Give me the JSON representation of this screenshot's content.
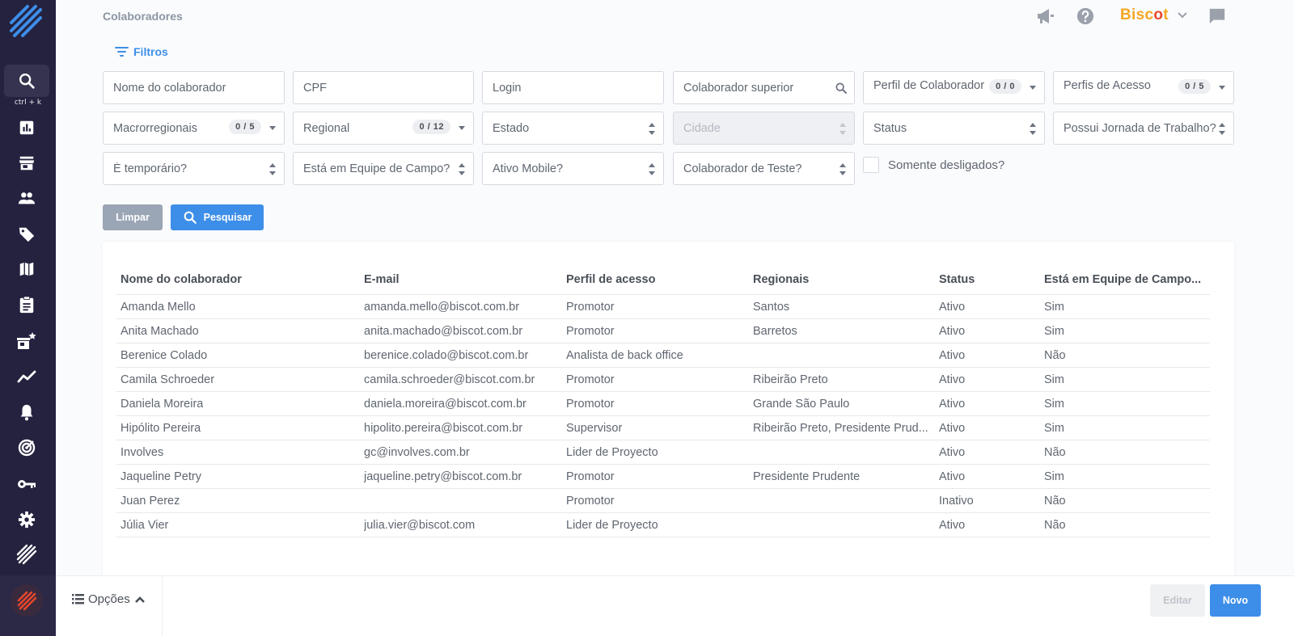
{
  "page": {
    "title": "Colaboradores"
  },
  "sidebar": {
    "shortcut": "ctrl + k",
    "icons": [
      "logo-icon",
      "search-icon",
      "dashboard-icon",
      "store-icon",
      "people-icon",
      "tag-icon",
      "map-icon",
      "clipboard-icon",
      "store-star-icon",
      "trend-icon",
      "bell-icon",
      "radar-icon",
      "key-icon",
      "gear-icon",
      "brand-stripes-icon"
    ]
  },
  "header": {
    "brand_prefix": "Bisc",
    "brand_dot": "o",
    "brand_suffix": "t",
    "brand_color": "#f5a623",
    "accent_color": "#e8472c"
  },
  "filters": {
    "link_label": "Filtros",
    "name": "Nome do colaborador",
    "cpf": "CPF",
    "login": "Login",
    "superior": "Colaborador superior",
    "perfil_colaborador": "Perfil de Colaborador",
    "perfil_colaborador_count": "0 / 0",
    "perfis_acesso": "Perfis de Acesso",
    "perfis_acesso_count": "0 / 5",
    "macroregionais": "Macrorregionais",
    "macroregionais_count": "0 / 5",
    "regional": "Regional",
    "regional_count": "0 / 12",
    "estado": "Estado",
    "cidade": "Cidade",
    "status": "Status",
    "jornada": "Possui Jornada de Trabalho?",
    "temporario": "É temporário?",
    "equipe_campo": "Está em Equipe de Campo?",
    "ativo_mobile": "Ativo Mobile?",
    "teste": "Colaborador de Teste?",
    "somente_desligados": "Somente desligados?"
  },
  "buttons": {
    "clear": "Limpar",
    "search": "Pesquisar",
    "edit": "Editar",
    "new": "Novo",
    "options": "Opções"
  },
  "table": {
    "columns": [
      "Nome do colaborador",
      "E-mail",
      "Perfil de acesso",
      "Regionais",
      "Status",
      "Está em Equipe de Campo..."
    ],
    "rows": [
      [
        "Amanda Mello",
        "amanda.mello@biscot.com.br",
        "Promotor",
        "Santos",
        "Ativo",
        "Sim"
      ],
      [
        "Anita Machado",
        "anita.machado@biscot.com.br",
        "Promotor",
        "Barretos",
        "Ativo",
        "Sim"
      ],
      [
        "Berenice Colado",
        "berenice.colado@biscot.com.br",
        "Analista de back office",
        "",
        "Ativo",
        "Não"
      ],
      [
        "Camila Schroeder",
        "camila.schroeder@biscot.com.br",
        "Promotor",
        "Ribeirão Preto",
        "Ativo",
        "Sim"
      ],
      [
        "Daniela Moreira",
        "daniela.moreira@biscot.com.br",
        "Promotor",
        "Grande São Paulo",
        "Ativo",
        "Sim"
      ],
      [
        "Hipólito Pereira",
        "hipolito.pereira@biscot.com.br",
        "Supervisor",
        "Ribeirão Preto, Presidente Prud...",
        "Ativo",
        "Sim"
      ],
      [
        "Involves",
        "gc@involves.com.br",
        "Lider de Proyecto",
        "",
        "Ativo",
        "Não"
      ],
      [
        "Jaqueline Petry",
        "jaqueline.petry@biscot.com.br",
        "Promotor",
        "Presidente Prudente",
        "Ativo",
        "Sim"
      ],
      [
        "Juan Perez",
        "",
        "Promotor",
        "",
        "Inativo",
        "Não"
      ],
      [
        "Júlia Vier",
        "julia.vier@biscot.com",
        "Lider de Proyecto",
        "",
        "Ativo",
        "Não"
      ]
    ]
  }
}
